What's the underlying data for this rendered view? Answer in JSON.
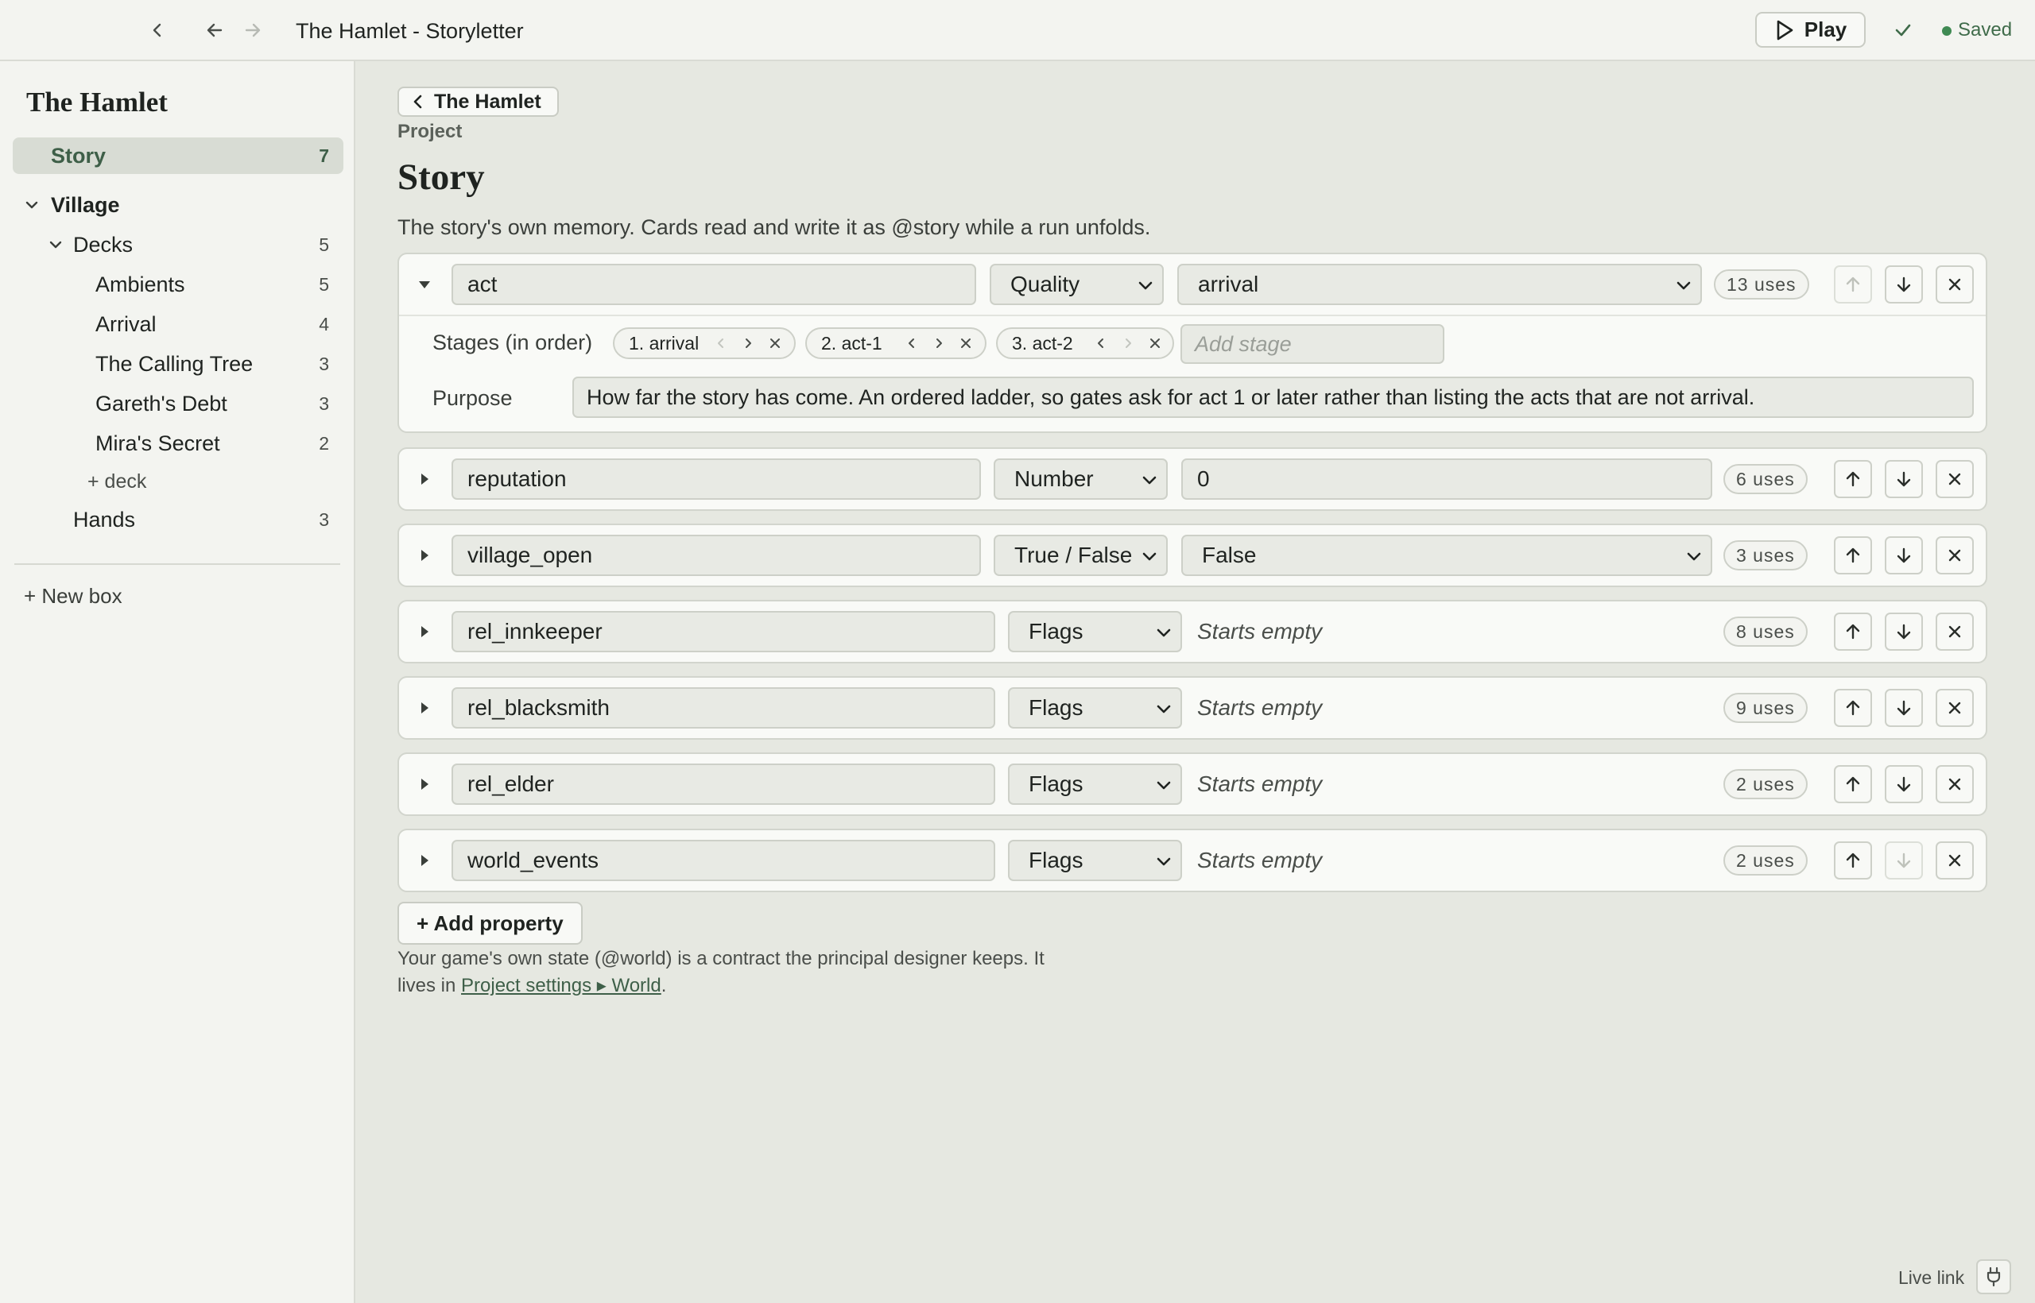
{
  "window": {
    "title": "The Hamlet - Storyletter"
  },
  "toolbar": {
    "play_label": "Play",
    "saved_label": "Saved"
  },
  "sidebar": {
    "project_name": "The Hamlet",
    "story": {
      "label": "Story",
      "count": "7"
    },
    "village": {
      "label": "Village"
    },
    "decks": {
      "label": "Decks",
      "count": "5"
    },
    "deck_items": [
      {
        "label": "Ambients",
        "count": "5"
      },
      {
        "label": "Arrival",
        "count": "4"
      },
      {
        "label": "The Calling Tree",
        "count": "3"
      },
      {
        "label": "Gareth's Debt",
        "count": "3"
      },
      {
        "label": "Mira's Secret",
        "count": "2"
      }
    ],
    "add_deck": "+ deck",
    "hands": {
      "label": "Hands",
      "count": "3"
    },
    "new_box": "+ New box"
  },
  "main": {
    "back_label": "The Hamlet",
    "crumb": "Project",
    "title": "Story",
    "description": "The story's own memory. Cards read and write it as @story while a run unfolds.",
    "properties": [
      {
        "name": "act",
        "type": "Quality",
        "value": "arrival",
        "uses": "13 uses",
        "stages_label": "Stages (in order)",
        "stages": [
          "1. arrival",
          "2. act-1",
          "3. act-2"
        ],
        "add_stage_placeholder": "Add stage",
        "purpose_label": "Purpose",
        "purpose": "How far the story has come. An ordered ladder, so gates ask for act 1 or later rather than listing the acts that are not arrival."
      },
      {
        "name": "reputation",
        "type": "Number",
        "value": "0",
        "uses": "6 uses"
      },
      {
        "name": "village_open",
        "type": "True / False",
        "value": "False",
        "uses": "3 uses"
      },
      {
        "name": "rel_innkeeper",
        "type": "Flags",
        "value": "Starts empty",
        "uses": "8 uses"
      },
      {
        "name": "rel_blacksmith",
        "type": "Flags",
        "value": "Starts empty",
        "uses": "9 uses"
      },
      {
        "name": "rel_elder",
        "type": "Flags",
        "value": "Starts empty",
        "uses": "2 uses"
      },
      {
        "name": "world_events",
        "type": "Flags",
        "value": "Starts empty",
        "uses": "2 uses"
      }
    ],
    "add_property": "+ Add property",
    "footnote_text": "Your game's own state (@world) is a contract the principal designer keeps. It lives in ",
    "footnote_link": "Project settings ▸ World",
    "footnote_end": "."
  },
  "status": {
    "live_link": "Live link"
  }
}
